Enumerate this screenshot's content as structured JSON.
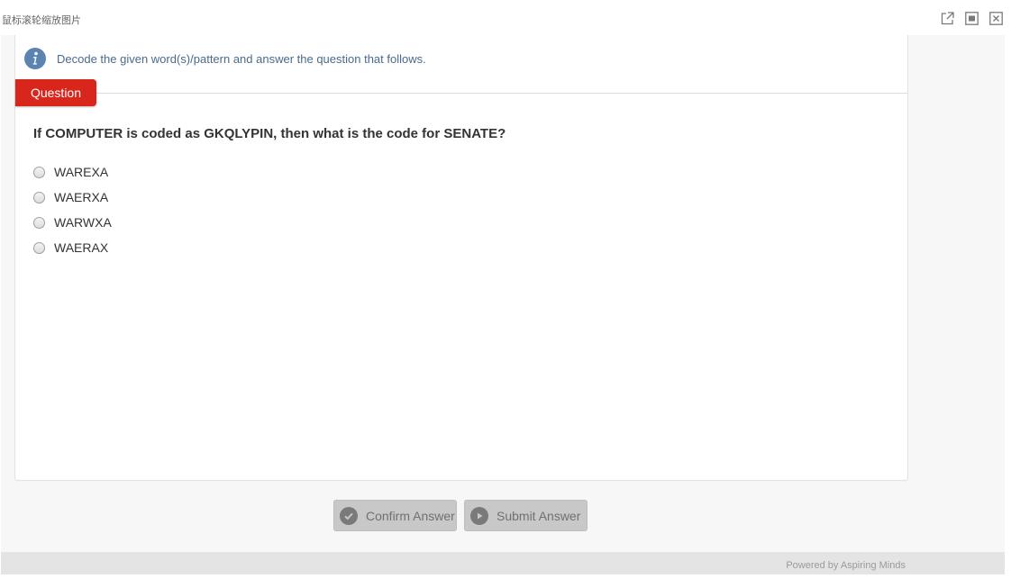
{
  "viewer": {
    "title": "鼠标滚轮缩放图片"
  },
  "instruction": {
    "text": "Decode the given word(s)/pattern and answer the question that follows."
  },
  "question": {
    "tab_label": "Question",
    "text": "If COMPUTER is coded as GKQLYPIN, then what is the code for SENATE?",
    "options": [
      {
        "label": "WAREXA",
        "selected": false
      },
      {
        "label": "WAERXA",
        "selected": false
      },
      {
        "label": "WARWXA",
        "selected": false
      },
      {
        "label": "WAERAX",
        "selected": false
      }
    ]
  },
  "actions": {
    "confirm_label": "Confirm Answer",
    "submit_label": "Submit Answer",
    "enabled": false
  },
  "footer": {
    "text": "Powered by Aspiring Minds"
  },
  "colors": {
    "tab_red": "#d9261c",
    "info_blue": "#5b84b1",
    "button_gray": "#c8c8c8"
  }
}
